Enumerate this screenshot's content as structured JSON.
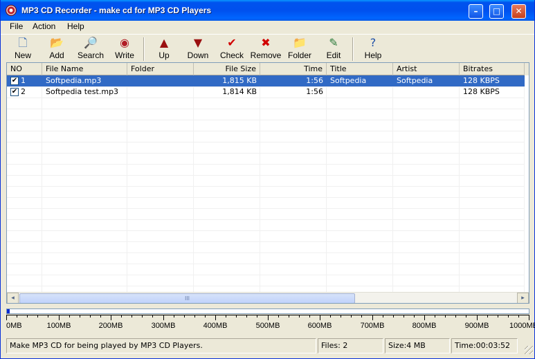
{
  "window": {
    "title": "MP3 CD Recorder - make cd for MP3 CD Players",
    "controls": {
      "minimize": "–",
      "maximize": "□",
      "close": "✕"
    }
  },
  "menu": [
    "File",
    "Action",
    "Help"
  ],
  "toolbar": [
    {
      "label": "New",
      "icon": "new-file-icon",
      "glyph": "🗋",
      "color": "#3f6fb5"
    },
    {
      "label": "Add",
      "icon": "add-files-icon",
      "glyph": "📂",
      "color": "#c99a1a"
    },
    {
      "label": "Search",
      "icon": "search-icon",
      "glyph": "🔎",
      "color": "#2f5fa0"
    },
    {
      "label": "Write",
      "icon": "write-cd-icon",
      "glyph": "◉",
      "color": "#b11c25"
    },
    {
      "label": "Up",
      "icon": "arrow-up-icon",
      "glyph": "▲",
      "color": "#9a1010"
    },
    {
      "label": "Down",
      "icon": "arrow-down-icon",
      "glyph": "▼",
      "color": "#9a1010"
    },
    {
      "label": "Check",
      "icon": "check-icon",
      "glyph": "✔",
      "color": "#d10000"
    },
    {
      "label": "Remove",
      "icon": "remove-icon",
      "glyph": "✖",
      "color": "#d10000"
    },
    {
      "label": "Folder",
      "icon": "folder-icon",
      "glyph": "📁",
      "color": "#d9b63a"
    },
    {
      "label": "Edit",
      "icon": "edit-icon",
      "glyph": "✎",
      "color": "#2a7a3a"
    },
    {
      "label": "Help",
      "icon": "help-icon",
      "glyph": "?",
      "color": "#1d4fa8"
    }
  ],
  "columns": [
    "NO",
    "File Name",
    "Folder",
    "File Size",
    "Time",
    "Title",
    "Artist",
    "Bitrates"
  ],
  "rows": [
    {
      "no": "1",
      "checked": true,
      "file_name": "Softpedia.mp3",
      "folder": "",
      "file_size": "1,815 KB",
      "time": "1:56",
      "title": "Softpedia",
      "artist": "Softpedia",
      "bitrates": "128 KBPS",
      "selected": true
    },
    {
      "no": "2",
      "checked": true,
      "file_name": "Softpedia test.mp3",
      "folder": "",
      "file_size": "1,814 KB",
      "time": "1:56",
      "title": "",
      "artist": "",
      "bitrates": "128 KBPS",
      "selected": false
    }
  ],
  "scrollbar": {
    "left": "◂",
    "right": "▸",
    "grip": "III"
  },
  "progress_fraction": 0.004,
  "ruler_labels": [
    "0MB",
    "100MB",
    "200MB",
    "300MB",
    "400MB",
    "500MB",
    "600MB",
    "700MB",
    "800MB",
    "900MB",
    "1000MB"
  ],
  "status": {
    "message": "Make MP3 CD for being played by MP3 CD Players.",
    "files": "Files: 2",
    "size": "Size:4 MB",
    "time": "Time:00:03:52"
  },
  "colors": {
    "selection": "#316ac5",
    "titlebar": "#0053ee",
    "progress": "#0a2bd0"
  }
}
